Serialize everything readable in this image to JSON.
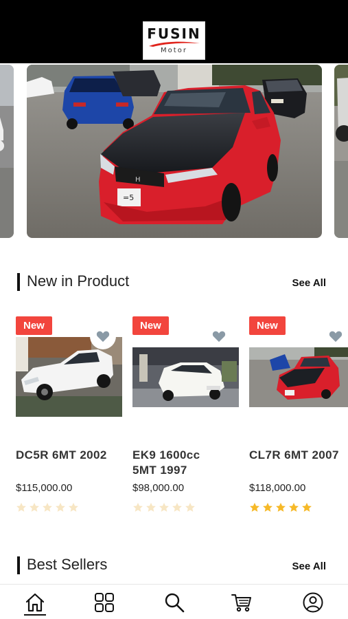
{
  "brand": {
    "name": "FUSIN",
    "tagline": "Motor",
    "accent": "#e0241c"
  },
  "carousel": {
    "slides": [
      {
        "name": "left-slide-partial"
      },
      {
        "name": "red-honda-accord-main"
      },
      {
        "name": "right-slide-partial"
      }
    ]
  },
  "new_in_product": {
    "title": "New in Product",
    "see_all": "See All",
    "items": [
      {
        "badge": "New",
        "title": "DC5R 6MT 2002",
        "price": "$115,000.00",
        "rating": 0,
        "car_color": "#f4f4f4"
      },
      {
        "badge": "New",
        "title": "EK9 1600cc\n5MT 1997",
        "price": "$98,000.00",
        "rating": 0,
        "car_color": "#f6f6f2"
      },
      {
        "badge": "New",
        "title": "CL7R 6MT 2007",
        "price": "$118,000.00",
        "rating": 5,
        "car_color": "#d9222a"
      }
    ]
  },
  "best_sellers": {
    "title": "Best Sellers",
    "see_all": "See All"
  },
  "bottom_nav": {
    "items": [
      {
        "icon": "home-icon"
      },
      {
        "icon": "grid-icon"
      },
      {
        "icon": "search-icon"
      },
      {
        "icon": "cart-icon"
      },
      {
        "icon": "profile-icon"
      }
    ]
  },
  "colors": {
    "badge": "#f2453d",
    "star_filled": "#f6b928",
    "star_empty": "#f7e6c4",
    "heart": "#8a9aa6"
  }
}
